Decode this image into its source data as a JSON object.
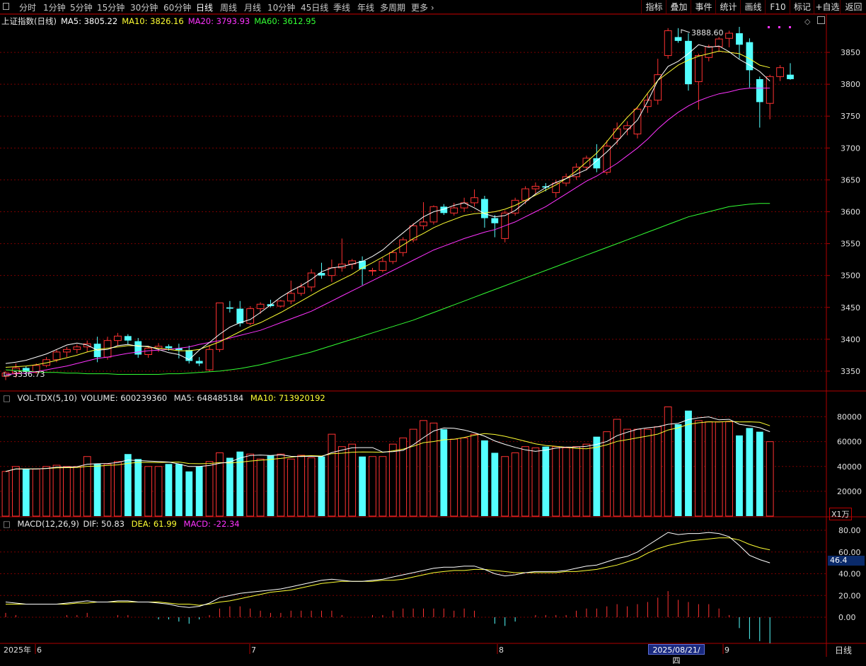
{
  "toolbar": {
    "periods": [
      "分时",
      "1分钟",
      "5分钟",
      "15分钟",
      "30分钟",
      "60分钟",
      "日线",
      "周线",
      "月线",
      "10分钟",
      "45日线",
      "季线",
      "年线",
      "多周期"
    ],
    "active_period": "日线",
    "more": "更多",
    "right_buttons": [
      "指标",
      "叠加",
      "事件",
      "统计",
      "画线",
      "F10",
      "标记",
      "+自选",
      "返回"
    ]
  },
  "main_chart": {
    "title": "上证指数(日线)",
    "ma": [
      {
        "label": "MA5: 3805.22",
        "color": "#ffffff"
      },
      {
        "label": "MA10: 3826.16",
        "color": "#ffff33"
      },
      {
        "label": "MA20: 3793.93",
        "color": "#ff33ff"
      },
      {
        "label": "MA60: 3612.95",
        "color": "#33ff33"
      }
    ],
    "high_label": "3888.60",
    "low_label": "3336.73",
    "y_ticks": [
      "3850",
      "3800",
      "3750",
      "3700",
      "3650",
      "3600",
      "3550",
      "3500",
      "3450",
      "3400",
      "3350"
    ]
  },
  "volume_chart": {
    "title": "VOL-TDX(5,10)",
    "volume": "VOLUME: 600239360",
    "ma5": "MA5: 648485184",
    "ma10": "MA10: 713920192",
    "y_ticks": [
      "80000",
      "60000",
      "40000",
      "20000"
    ],
    "unit": "X1万"
  },
  "macd_chart": {
    "title": "MACD(12,26,9)",
    "dif": "DIF: 50.83",
    "dea": "DEA: 61.99",
    "macd": "MACD: -22.34",
    "y_ticks": [
      "80.00",
      "60.00",
      "40.00",
      "20.00",
      "0.00"
    ],
    "cursor_value": "46.4"
  },
  "x_axis": {
    "labels": [
      "2025年",
      "6",
      "7",
      "8",
      "9"
    ],
    "cursor_date": "2025/08/21/四",
    "period_label": "日线"
  },
  "colors": {
    "up": "#ff3232",
    "down": "#54ffff",
    "grid": "#7a0000",
    "axis": "#b00000"
  },
  "chart_data": {
    "type": "candlestick",
    "price_range": [
      3320,
      3900
    ],
    "candles": [
      [
        3342,
        3350,
        3336,
        3347
      ],
      [
        3347,
        3362,
        3340,
        3355
      ],
      [
        3355,
        3358,
        3344,
        3349
      ],
      [
        3348,
        3362,
        3346,
        3359
      ],
      [
        3359,
        3372,
        3356,
        3368
      ],
      [
        3368,
        3384,
        3364,
        3380
      ],
      [
        3380,
        3388,
        3372,
        3384
      ],
      [
        3384,
        3392,
        3378,
        3388
      ],
      [
        3388,
        3398,
        3380,
        3393
      ],
      [
        3393,
        3404,
        3364,
        3372
      ],
      [
        3372,
        3404,
        3368,
        3398
      ],
      [
        3398,
        3410,
        3390,
        3405
      ],
      [
        3405,
        3408,
        3392,
        3398
      ],
      [
        3397,
        3402,
        3371,
        3376
      ],
      [
        3376,
        3389,
        3371,
        3386
      ],
      [
        3386,
        3394,
        3380,
        3389
      ],
      [
        3389,
        3392,
        3382,
        3386
      ],
      [
        3386,
        3393,
        3370,
        3383
      ],
      [
        3383,
        3390,
        3362,
        3366
      ],
      [
        3366,
        3372,
        3358,
        3362
      ],
      [
        3352,
        3390,
        3350,
        3384
      ],
      [
        3384,
        3450,
        3380,
        3457
      ],
      [
        3450,
        3460,
        3442,
        3448
      ],
      [
        3448,
        3460,
        3420,
        3425
      ],
      [
        3425,
        3452,
        3422,
        3448
      ],
      [
        3448,
        3458,
        3440,
        3455
      ],
      [
        3455,
        3462,
        3450,
        3452
      ],
      [
        3452,
        3462,
        3450,
        3460
      ],
      [
        3460,
        3492,
        3455,
        3472
      ],
      [
        3472,
        3488,
        3468,
        3482
      ],
      [
        3482,
        3510,
        3475,
        3504
      ],
      [
        3504,
        3520,
        3495,
        3500
      ],
      [
        3500,
        3525,
        3490,
        3512
      ],
      [
        3512,
        3558,
        3506,
        3518
      ],
      [
        3518,
        3526,
        3510,
        3523
      ],
      [
        3523,
        3530,
        3485,
        3510
      ],
      [
        3508,
        3512,
        3500,
        3508
      ],
      [
        3508,
        3528,
        3505,
        3522
      ],
      [
        3522,
        3540,
        3518,
        3536
      ],
      [
        3536,
        3560,
        3530,
        3556
      ],
      [
        3556,
        3582,
        3552,
        3578
      ],
      [
        3578,
        3615,
        3572,
        3584
      ],
      [
        3584,
        3610,
        3580,
        3608
      ],
      [
        3608,
        3612,
        3595,
        3598
      ],
      [
        3598,
        3614,
        3594,
        3606
      ],
      [
        3606,
        3622,
        3600,
        3614
      ],
      [
        3614,
        3635,
        3608,
        3622
      ],
      [
        3620,
        3625,
        3575,
        3590
      ],
      [
        3590,
        3595,
        3560,
        3582
      ],
      [
        3558,
        3602,
        3552,
        3598
      ],
      [
        3598,
        3622,
        3594,
        3618
      ],
      [
        3618,
        3640,
        3612,
        3636
      ],
      [
        3636,
        3646,
        3628,
        3640
      ],
      [
        3640,
        3645,
        3632,
        3638
      ],
      [
        3630,
        3650,
        3622,
        3645
      ],
      [
        3645,
        3660,
        3640,
        3655
      ],
      [
        3655,
        3676,
        3650,
        3670
      ],
      [
        3670,
        3688,
        3665,
        3684
      ],
      [
        3684,
        3706,
        3662,
        3668
      ],
      [
        3662,
        3712,
        3658,
        3703
      ],
      [
        3715,
        3740,
        3705,
        3730
      ],
      [
        3730,
        3742,
        3720,
        3735
      ],
      [
        3722,
        3765,
        3715,
        3761
      ],
      [
        3765,
        3785,
        3755,
        3775
      ],
      [
        3775,
        3840,
        3768,
        3815
      ],
      [
        3845,
        3888,
        3840,
        3884
      ],
      [
        3874,
        3888,
        3865,
        3868
      ],
      [
        3868,
        3880,
        3790,
        3800
      ],
      [
        3804,
        3848,
        3760,
        3845
      ],
      [
        3842,
        3862,
        3836,
        3859
      ],
      [
        3859,
        3874,
        3852,
        3871
      ],
      [
        3872,
        3884,
        3858,
        3880
      ],
      [
        3880,
        3890,
        3840,
        3862
      ],
      [
        3866,
        3872,
        3795,
        3822
      ],
      [
        3808,
        3812,
        3732,
        3772
      ],
      [
        3770,
        3815,
        3745,
        3812
      ],
      [
        3812,
        3830,
        3805,
        3826
      ],
      [
        3815,
        3833,
        3807,
        3808
      ]
    ],
    "ma5": [
      3362,
      3364,
      3367,
      3372,
      3377,
      3384,
      3391,
      3394,
      3391,
      3383,
      3384,
      3390,
      3392,
      3389,
      3389,
      3384,
      3379,
      3376,
      3368,
      3383,
      3395,
      3408,
      3419,
      3426,
      3431,
      3442,
      3454,
      3466,
      3476,
      3484,
      3494,
      3506,
      3512,
      3514,
      3518,
      3522,
      3530,
      3540,
      3554,
      3567,
      3580,
      3592,
      3600,
      3604,
      3610,
      3614,
      3606,
      3597,
      3592,
      3594,
      3602,
      3615,
      3628,
      3638,
      3646,
      3652,
      3659,
      3666,
      3680,
      3694,
      3710,
      3728,
      3744,
      3773,
      3806,
      3828,
      3836,
      3848,
      3862,
      3858,
      3860,
      3851,
      3839,
      3830,
      3820,
      3805
    ],
    "ma10": [
      3356,
      3357,
      3358,
      3360,
      3363,
      3367,
      3371,
      3375,
      3380,
      3384,
      3386,
      3388,
      3390,
      3390,
      3388,
      3386,
      3384,
      3382,
      3382,
      3384,
      3390,
      3396,
      3404,
      3412,
      3420,
      3426,
      3434,
      3442,
      3451,
      3460,
      3469,
      3478,
      3486,
      3494,
      3502,
      3512,
      3520,
      3529,
      3538,
      3548,
      3558,
      3566,
      3575,
      3582,
      3588,
      3594,
      3597,
      3598,
      3600,
      3604,
      3610,
      3618,
      3626,
      3634,
      3642,
      3652,
      3664,
      3678,
      3692,
      3710,
      3730,
      3748,
      3764,
      3786,
      3806,
      3818,
      3830,
      3838,
      3844,
      3848,
      3852,
      3850,
      3848,
      3840,
      3830,
      3826
    ],
    "ma20": [
      3345,
      3346,
      3347,
      3349,
      3352,
      3355,
      3358,
      3362,
      3366,
      3370,
      3372,
      3375,
      3378,
      3380,
      3382,
      3383,
      3384,
      3386,
      3388,
      3392,
      3395,
      3398,
      3402,
      3406,
      3410,
      3414,
      3420,
      3426,
      3432,
      3438,
      3444,
      3452,
      3460,
      3468,
      3476,
      3484,
      3492,
      3500,
      3508,
      3516,
      3524,
      3532,
      3540,
      3546,
      3552,
      3558,
      3563,
      3568,
      3572,
      3578,
      3584,
      3592,
      3600,
      3608,
      3618,
      3628,
      3638,
      3648,
      3656,
      3666,
      3676,
      3688,
      3700,
      3714,
      3730,
      3744,
      3756,
      3766,
      3774,
      3780,
      3785,
      3788,
      3792,
      3794,
      3794,
      3794
    ],
    "ma60": [
      3352,
      3351,
      3350,
      3349,
      3348,
      3348,
      3347,
      3347,
      3346,
      3346,
      3346,
      3345,
      3345,
      3345,
      3345,
      3345,
      3346,
      3346,
      3347,
      3348,
      3349,
      3350,
      3352,
      3354,
      3357,
      3360,
      3364,
      3368,
      3372,
      3376,
      3380,
      3385,
      3390,
      3395,
      3400,
      3405,
      3410,
      3415,
      3420,
      3425,
      3430,
      3436,
      3442,
      3448,
      3454,
      3460,
      3466,
      3472,
      3478,
      3484,
      3490,
      3496,
      3502,
      3508,
      3514,
      3520,
      3526,
      3532,
      3538,
      3544,
      3550,
      3556,
      3562,
      3568,
      3574,
      3580,
      3586,
      3592,
      3596,
      3600,
      3604,
      3608,
      3610,
      3612,
      3613,
      3613
    ],
    "volume": [
      36000,
      40000,
      38000,
      38000,
      40000,
      41000,
      40000,
      40000,
      48000,
      42000,
      42000,
      44000,
      50000,
      46000,
      40000,
      40000,
      42000,
      42000,
      36000,
      40000,
      44000,
      51000,
      47000,
      52000,
      50000,
      46000,
      49000,
      50000,
      46000,
      49000,
      47000,
      48000,
      66000,
      56000,
      58000,
      48000,
      48000,
      48000,
      58000,
      63000,
      70000,
      77000,
      75000,
      70000,
      62000,
      63000,
      66000,
      61000,
      51000,
      48000,
      51000,
      56000,
      55000,
      56000,
      56000,
      55000,
      56000,
      58000,
      64000,
      68000,
      78000,
      70000,
      70000,
      70000,
      72000,
      88000,
      74000,
      85000,
      77000,
      76000,
      76000,
      76000,
      65000,
      71000,
      68000,
      60000
    ],
    "macd_dif": [
      14,
      13,
      12,
      12,
      12,
      12,
      13,
      14,
      15,
      14,
      14,
      15,
      15,
      14,
      14,
      13,
      12,
      10,
      9,
      10,
      13,
      18,
      20,
      22,
      23,
      24,
      25,
      26,
      28,
      30,
      32,
      34,
      35,
      34,
      33,
      33,
      34,
      35,
      37,
      39,
      41,
      43,
      45,
      46,
      46,
      47,
      47,
      44,
      40,
      38,
      39,
      41,
      42,
      42,
      42,
      43,
      45,
      47,
      48,
      51,
      54,
      56,
      60,
      66,
      72,
      78,
      76,
      77,
      77,
      78,
      77,
      74,
      66,
      57,
      53,
      50
    ],
    "macd_dea": [
      12,
      12,
      12,
      12,
      12,
      12,
      12,
      13,
      13,
      14,
      14,
      14,
      14,
      14,
      14,
      14,
      13,
      12,
      12,
      11,
      12,
      14,
      15,
      17,
      19,
      21,
      23,
      24,
      25,
      27,
      29,
      31,
      32,
      33,
      33,
      33,
      33,
      34,
      34,
      35,
      37,
      39,
      41,
      42,
      43,
      43,
      44,
      44,
      43,
      42,
      41,
      41,
      41,
      41,
      41,
      42,
      42,
      43,
      44,
      46,
      48,
      51,
      54,
      59,
      63,
      66,
      68,
      70,
      71,
      72,
      73,
      73,
      71,
      67,
      64,
      62
    ],
    "x": "trading days from late May 2025 to September 2025"
  }
}
